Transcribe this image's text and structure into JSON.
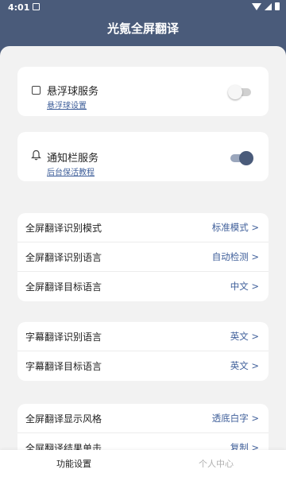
{
  "status_bar": {
    "time": "4:01"
  },
  "app_bar": {
    "title": "光氪全屏翻译"
  },
  "floating_service": {
    "title": "悬浮球服务",
    "subtitle": "悬浮球设置",
    "toggle_on": false
  },
  "notification_service": {
    "title": "通知栏服务",
    "subtitle": "后台保活教程",
    "toggle_on": true
  },
  "group1": [
    {
      "label": "全屏翻译识别模式",
      "value": "标准模式 >"
    },
    {
      "label": "全屏翻译识别语言",
      "value": "自动检测 >"
    },
    {
      "label": "全屏翻译目标语言",
      "value": "中文 >"
    }
  ],
  "group2": [
    {
      "label": "字幕翻译识别语言",
      "value": "英文 >"
    },
    {
      "label": "字幕翻译目标语言",
      "value": "英文 >"
    }
  ],
  "group3": [
    {
      "label": "全屏翻译显示风格",
      "value": "透底白字 >"
    },
    {
      "label": "全屏翻译结果单击",
      "value": "复制 >"
    }
  ],
  "tabs": {
    "settings": "功能设置",
    "profile": "个人中心"
  },
  "colors": {
    "primary": "#4a5b7a",
    "link": "#3f5f9a",
    "background": "#f2f2f2"
  }
}
